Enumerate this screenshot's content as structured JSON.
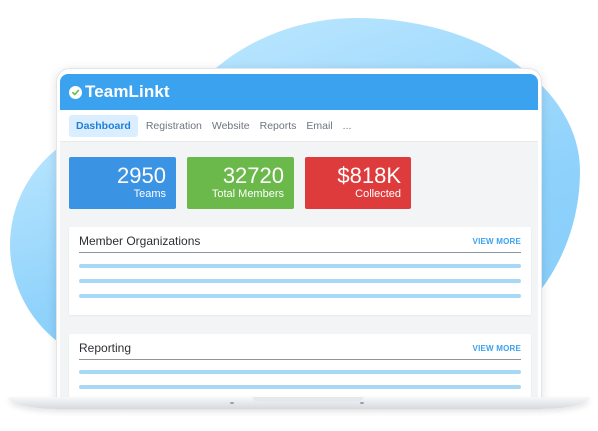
{
  "app": {
    "logo_text": "TeamLinkt"
  },
  "nav": {
    "items": [
      {
        "label": "Dashboard",
        "active": true
      },
      {
        "label": "Registration"
      },
      {
        "label": "Website"
      },
      {
        "label": "Reports"
      },
      {
        "label": "Email"
      },
      {
        "label": "..."
      }
    ]
  },
  "stats": [
    {
      "value": "2950",
      "label": "Teams",
      "color": "#3b93e3"
    },
    {
      "value": "32720",
      "label": "Total Members",
      "color": "#6ab94a"
    },
    {
      "value": "$818K",
      "label": "Collected",
      "color": "#de3c3c"
    }
  ],
  "cards": [
    {
      "title": "Member Organizations",
      "action": "VIEW MORE"
    },
    {
      "title": "Reporting",
      "action": "VIEW MORE"
    }
  ],
  "colors": {
    "header": "#3aa2ef",
    "accent": "#1f7fd6",
    "placeholder_bar": "#a9d8f7"
  }
}
